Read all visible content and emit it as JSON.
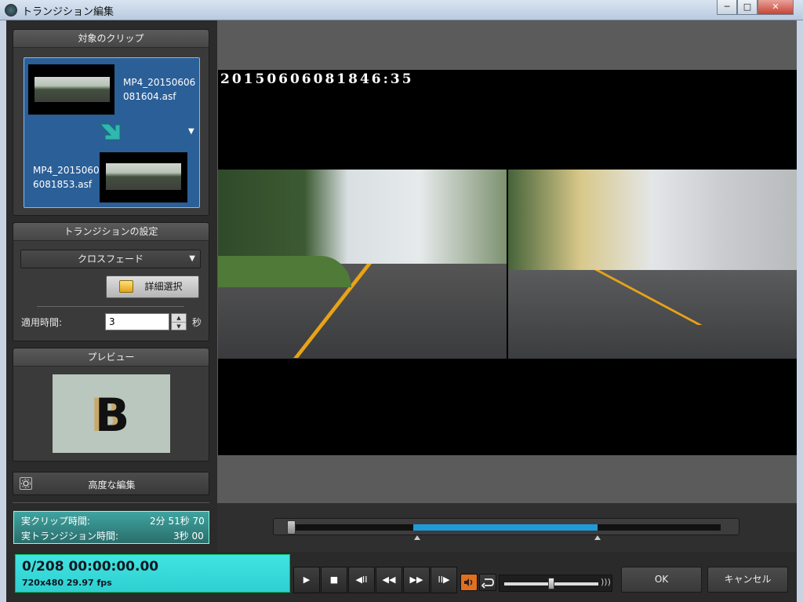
{
  "window": {
    "title": "トランジション編集",
    "minimize": "─",
    "maximize": "□",
    "close": "✕"
  },
  "clips": {
    "header": "対象のクリップ",
    "clip_a": "MP4_20150606\n081604.asf",
    "clip_b": "MP4_2015060\n6081853.asf",
    "dropdown_arrow": "▼",
    "arrow_icon": "arrow-down-right-icon"
  },
  "transition": {
    "header": "トランジションの設定",
    "type": "クロスフェード",
    "detail_button": "詳細選択",
    "duration_label": "適用時間:",
    "duration_value": "3",
    "duration_unit": "秒"
  },
  "preview": {
    "header": "プレビュー",
    "letter": "B"
  },
  "advanced": {
    "label": "高度な編集"
  },
  "info": {
    "clip_time_label": "実クリップ時間:",
    "clip_time_value": "2分 51秒 70",
    "transition_time_label": "実トランジション時間:",
    "transition_time_value": "3秒 00"
  },
  "video": {
    "timestamp": "20150606081846:35"
  },
  "counter": {
    "frame": "0/208 00:00:00.00",
    "format": "720x480 29.97 fps"
  },
  "controls": {
    "play": "▶",
    "stop": "■",
    "prev_frame": "◀II",
    "rewind": "◀◀",
    "forward": "▶▶",
    "next_frame": "II▶"
  },
  "buttons": {
    "ok": "OK",
    "cancel": "キャンセル"
  },
  "colors": {
    "accent": "#1e9bd7",
    "counter_bg": "#2fcfd0",
    "clip_selected": "#2b5f97",
    "audio_toggle": "#e07020"
  }
}
